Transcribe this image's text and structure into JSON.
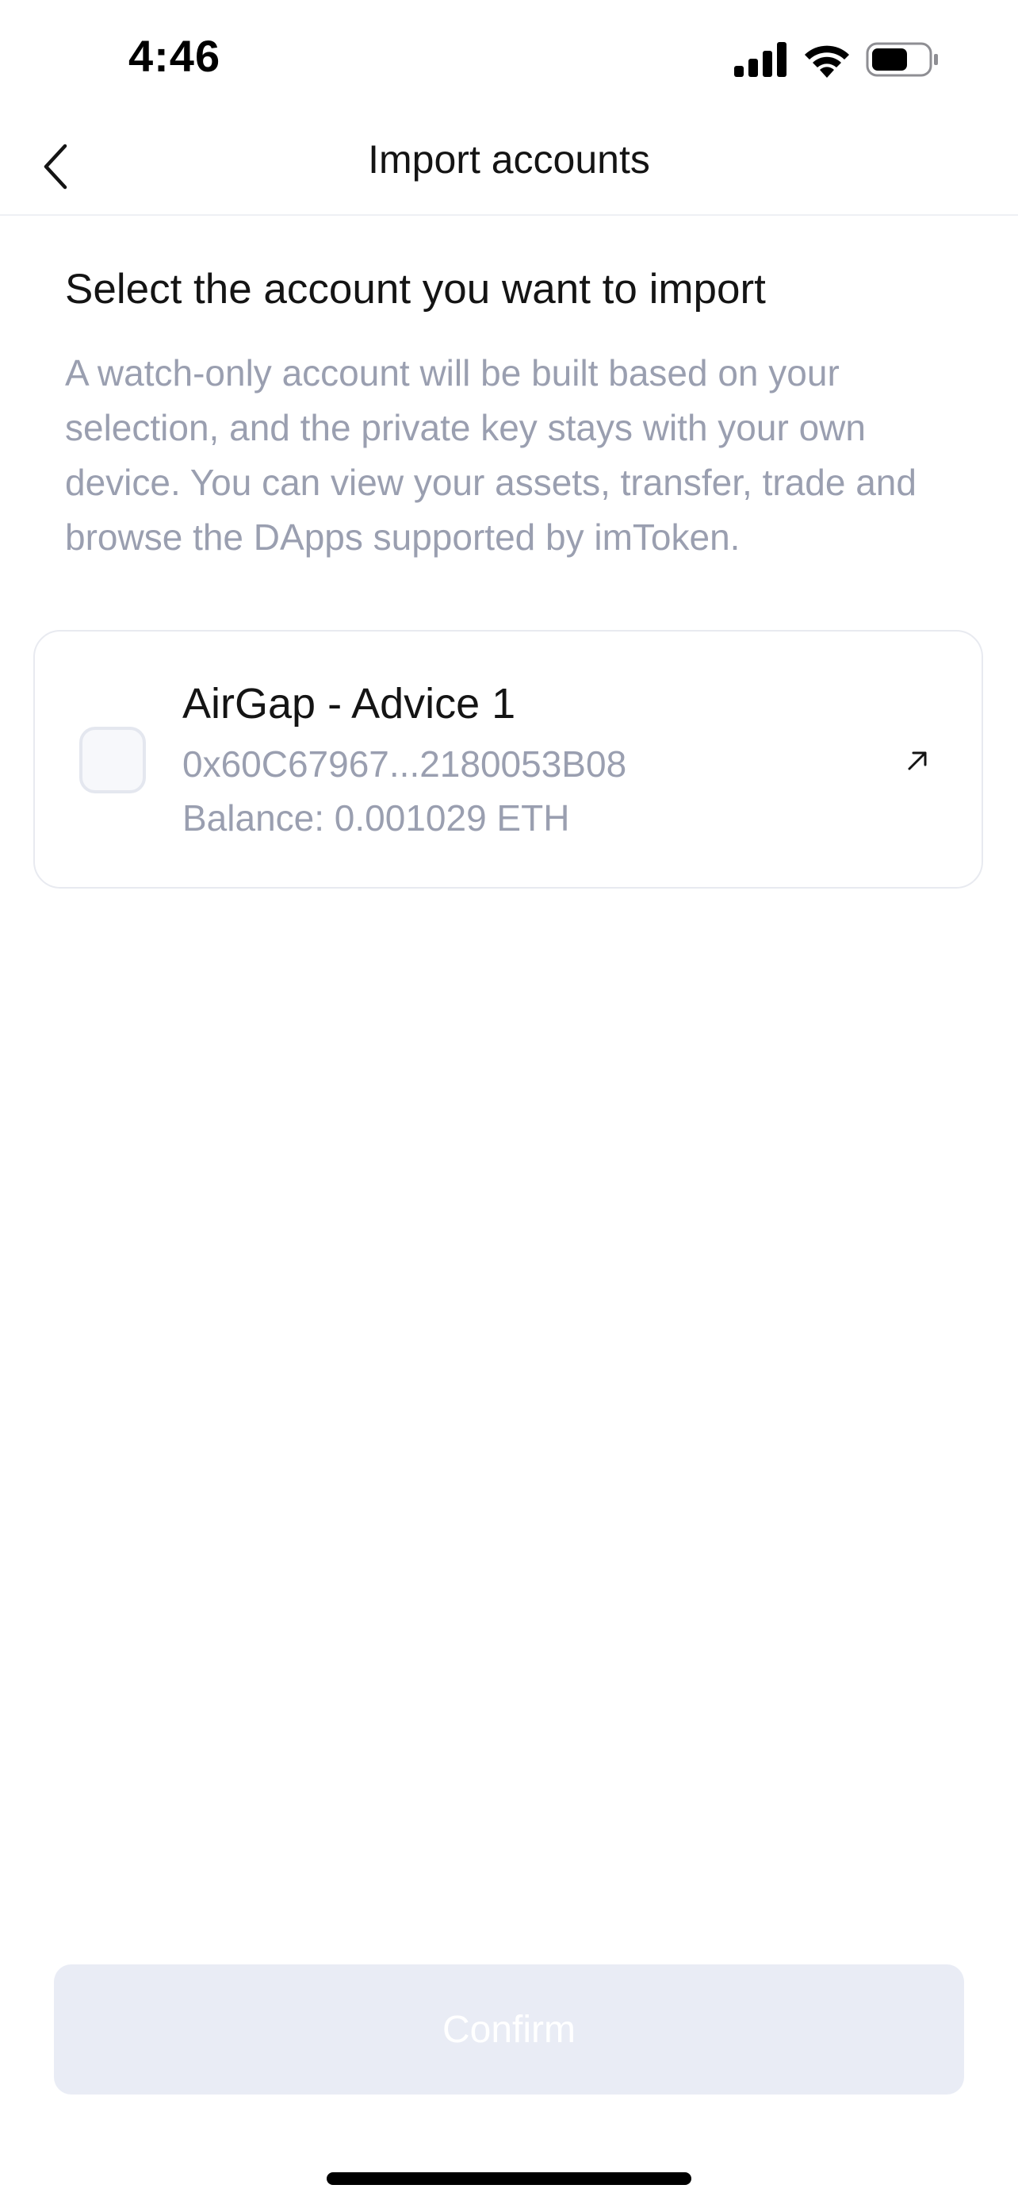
{
  "status_bar": {
    "time": "4:46",
    "icons": [
      "signal-icon",
      "wifi-icon",
      "battery-icon"
    ]
  },
  "nav": {
    "back_icon": "chevron-left-icon",
    "title": "Import accounts"
  },
  "content": {
    "heading": "Select the account you want to import",
    "description": "A watch-only account will be built based on your selection, and the private key stays with your own device. You can view your assets, transfer, trade and browse the DApps supported by imToken."
  },
  "accounts": [
    {
      "name": "AirGap - Advice 1",
      "address": "0x60C67967...2180053B08",
      "balance": "Balance: 0.001029 ETH",
      "selected": false,
      "link_icon": "external-link-icon"
    }
  ],
  "confirm": {
    "label": "Confirm",
    "enabled": false
  },
  "colors": {
    "text_primary": "#141414",
    "text_secondary": "#9a9fb0",
    "button_disabled_bg": "#e9ecf5",
    "card_border": "#e8eaf0"
  }
}
